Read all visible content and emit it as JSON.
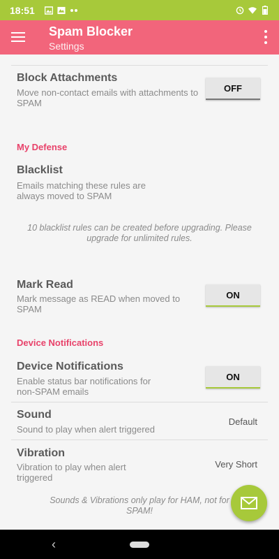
{
  "status_bar": {
    "time": "18:51",
    "left_icons": [
      "image-icon",
      "photo-icon",
      "more-dots-icon"
    ],
    "right_icons": [
      "alarm-icon",
      "wifi-icon",
      "battery-icon"
    ]
  },
  "app_bar": {
    "title": "Spam Blocker",
    "subtitle": "Settings"
  },
  "settings": {
    "block_attachments": {
      "title": "Block Attachments",
      "summary": "Move non-contact emails with attachments to SPAM",
      "toggle": "OFF"
    },
    "my_defense_header": "My Defense",
    "blacklist": {
      "title": "Blacklist",
      "summary": "Emails matching these rules are always moved to SPAM"
    },
    "blacklist_note": "10 blacklist rules can be created before upgrading. Please upgrade for unlimited rules.",
    "mark_read": {
      "title": "Mark Read",
      "summary": "Mark message as READ when moved to SPAM",
      "toggle": "ON"
    },
    "device_notifications_header": "Device Notifications",
    "device_notifications": {
      "title": "Device Notifications",
      "summary": "Enable status bar notifications for non-SPAM emails",
      "toggle": "ON"
    },
    "sound": {
      "title": "Sound",
      "summary": "Sound to play when alert triggered",
      "value": "Default"
    },
    "vibration": {
      "title": "Vibration",
      "summary": "Vibration to play when alert triggered",
      "value": "Very Short"
    },
    "sounds_note": "Sounds & Vibrations only play for HAM, not for SPAM!"
  },
  "fab": {
    "icon": "mail-icon"
  },
  "colors": {
    "status_bar": "#a7c93a",
    "app_bar": "#f2657b",
    "category_header": "#e8426a",
    "accent": "#a7c93a"
  }
}
